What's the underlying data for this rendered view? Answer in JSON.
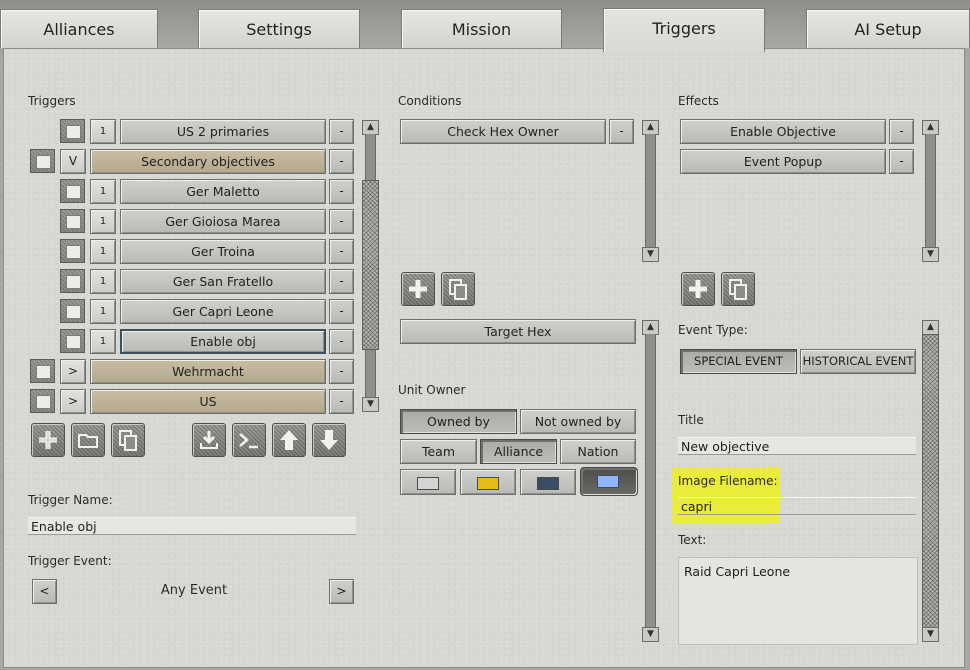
{
  "tabs": [
    "Alliances",
    "Settings",
    "Mission",
    "Triggers",
    "AI Setup"
  ],
  "active_tab": "Triggers",
  "triggers": {
    "heading": "Triggers",
    "items": [
      {
        "label": "US 2 primaries",
        "badge": "1",
        "style": "plain",
        "indent": true
      },
      {
        "label": "Secondary objectives",
        "badge": "V",
        "style": "tan",
        "indent": false
      },
      {
        "label": "Ger Maletto",
        "badge": "1",
        "style": "plain",
        "indent": true
      },
      {
        "label": "Ger Gioiosa Marea",
        "badge": "1",
        "style": "plain",
        "indent": true
      },
      {
        "label": "Ger Troina",
        "badge": "1",
        "style": "plain",
        "indent": true
      },
      {
        "label": "Ger San Fratello",
        "badge": "1",
        "style": "plain",
        "indent": true
      },
      {
        "label": "Ger Capri Leone",
        "badge": "1",
        "style": "plain",
        "indent": true
      },
      {
        "label": "Enable obj",
        "badge": "1",
        "style": "selected",
        "indent": true
      },
      {
        "label": "Wehrmacht",
        "badge": ">",
        "style": "tan",
        "indent": false
      },
      {
        "label": "US",
        "badge": ">",
        "style": "tan",
        "indent": false
      }
    ],
    "minus_label": "-",
    "trigger_name_label": "Trigger Name:",
    "trigger_name_value": "Enable obj",
    "trigger_event_label": "Trigger Event:",
    "trigger_event_value": "Any Event",
    "prev_label": "<",
    "next_label": ">"
  },
  "conditions": {
    "heading": "Conditions",
    "items": [
      "Check Hex Owner"
    ],
    "minus_label": "-",
    "target_hex_label": "Target Hex",
    "unit_owner_label": "Unit Owner",
    "owned_by_label": "Owned by",
    "not_owned_by_label": "Not owned by",
    "team_label": "Team",
    "alliance_label": "Alliance",
    "nation_label": "Nation",
    "swatch_colors": [
      "#d4d4d4",
      "#e3bc16",
      "#3b4d66",
      "#8fb7ff"
    ]
  },
  "effects": {
    "heading": "Effects",
    "items": [
      "Enable Objective",
      "Event Popup"
    ],
    "minus_label": "-",
    "event_type_label": "Event Type:",
    "special_event_label": "SPECIAL EVENT",
    "historical_event_label": "HISTORICAL EVENT",
    "title_label": "Title",
    "title_value": "New objective",
    "image_filename_label": "Image Filename:",
    "image_filename_value": "capri",
    "text_label": "Text:",
    "text_value": "Raid Capri Leone"
  },
  "colors": {
    "highlight": "#eaec3a",
    "tan": "#c0b49b"
  }
}
